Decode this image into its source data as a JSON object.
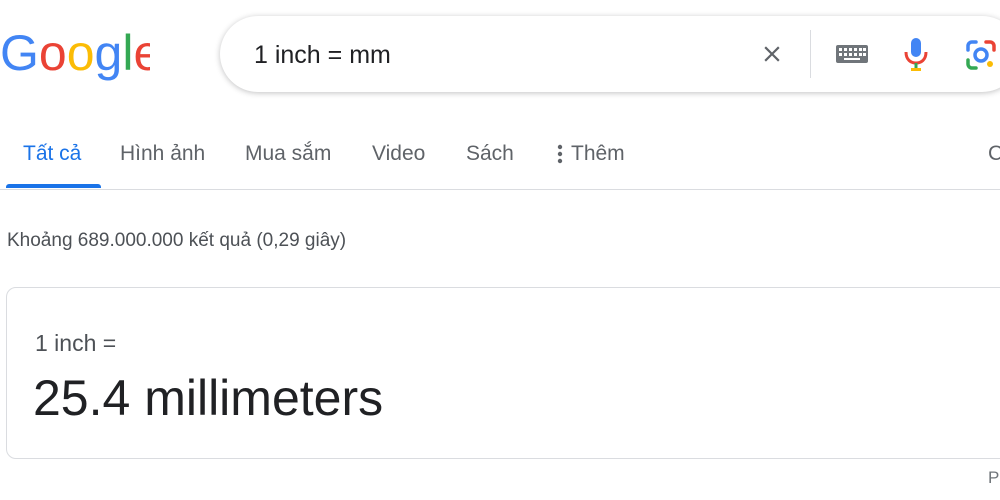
{
  "header": {
    "logo_text": "Google",
    "search_query": "1 inch = mm",
    "icons": {
      "clear": "close-icon",
      "keyboard": "keyboard-icon",
      "voice": "microphone-icon",
      "lens": "google-lens-icon"
    }
  },
  "tabs": {
    "items": [
      {
        "label": "Tất cả",
        "active": true
      },
      {
        "label": "Hình ảnh",
        "active": false
      },
      {
        "label": "Mua sắm",
        "active": false
      },
      {
        "label": "Video",
        "active": false
      },
      {
        "label": "Sách",
        "active": false
      }
    ],
    "more_label": "Thêm",
    "tools_label": "C"
  },
  "results": {
    "stats": "Khoảng 689.000.000 kết quả (0,29 giây)"
  },
  "converter": {
    "from": "1 inch =",
    "result": "25.4 millimeters"
  },
  "footer": {
    "corner_label": "P"
  },
  "colors": {
    "accent": "#1a73e8",
    "logo_blue": "#4285f4",
    "logo_red": "#ea4335",
    "logo_yellow": "#fbbc05",
    "logo_green": "#34a853"
  }
}
